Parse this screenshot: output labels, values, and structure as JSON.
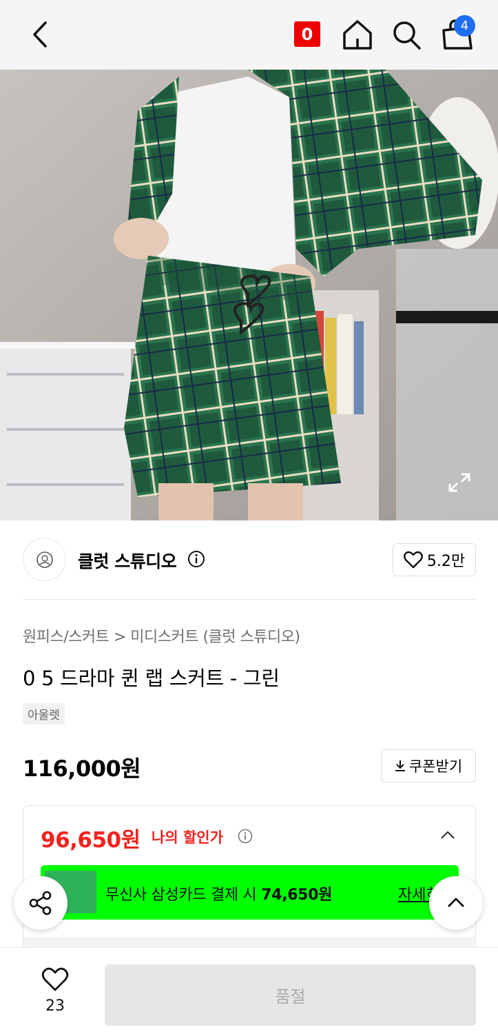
{
  "header": {
    "back_icon": "chevron-left-icon",
    "badge_label": "0",
    "cart_count": "4",
    "accent": "#e00000",
    "cart_badge_color": "#1e6ef0"
  },
  "brand": {
    "name": "클럿 스튜디오",
    "likes": "5.2만"
  },
  "product": {
    "breadcrumb": "원피스/스커트 > 미디스커트 (클럿 스튜디오)",
    "title": "0 5 드라마 퀸 랩 스커트 - 그린",
    "tag": "아울렛",
    "price": "116,000원",
    "coupon_label": "쿠폰받기"
  },
  "discount": {
    "my_price": "96,650원",
    "my_label": "나의 할인가",
    "promo_text": "무신사 삼성카드 결제 시",
    "promo_price": "74,650원",
    "promo_more": "자세히",
    "promo_color": "#00ff00",
    "price_color": "#f0231e"
  },
  "bottom": {
    "wish_count": "23",
    "soldout_label": "품절"
  }
}
